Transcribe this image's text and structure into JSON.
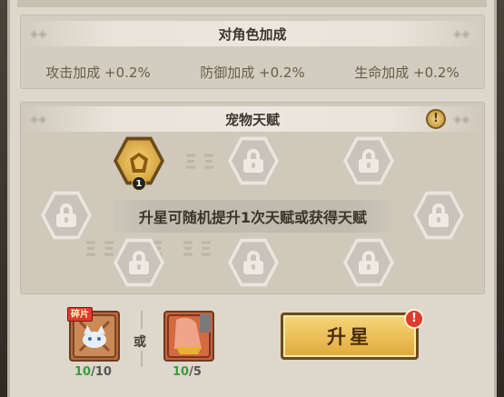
{
  "stats_section": {
    "title": "对角色加成",
    "bonuses": [
      "攻击加成 +0.2%",
      "防御加成 +0.2%",
      "生命加成 +0.2%"
    ]
  },
  "talent_section": {
    "title": "宠物天赋",
    "info_icon": "exclamation-icon",
    "unlocked_talent_level": "1",
    "hint": "升星可随机提升1次天赋或获得天赋"
  },
  "materials": {
    "fragment_tag": "碎片",
    "fragment_have": "10",
    "fragment_need": "/10",
    "or_label": "或",
    "item_have": "10",
    "item_need": "/5"
  },
  "upgrade_button": {
    "label": "升星",
    "alert": "!"
  },
  "colors": {
    "accent_gold": "#e0a93a",
    "panel_bg": "#ddd7cc",
    "alert_red": "#e03a2c",
    "count_green": "#3d9b3a"
  }
}
